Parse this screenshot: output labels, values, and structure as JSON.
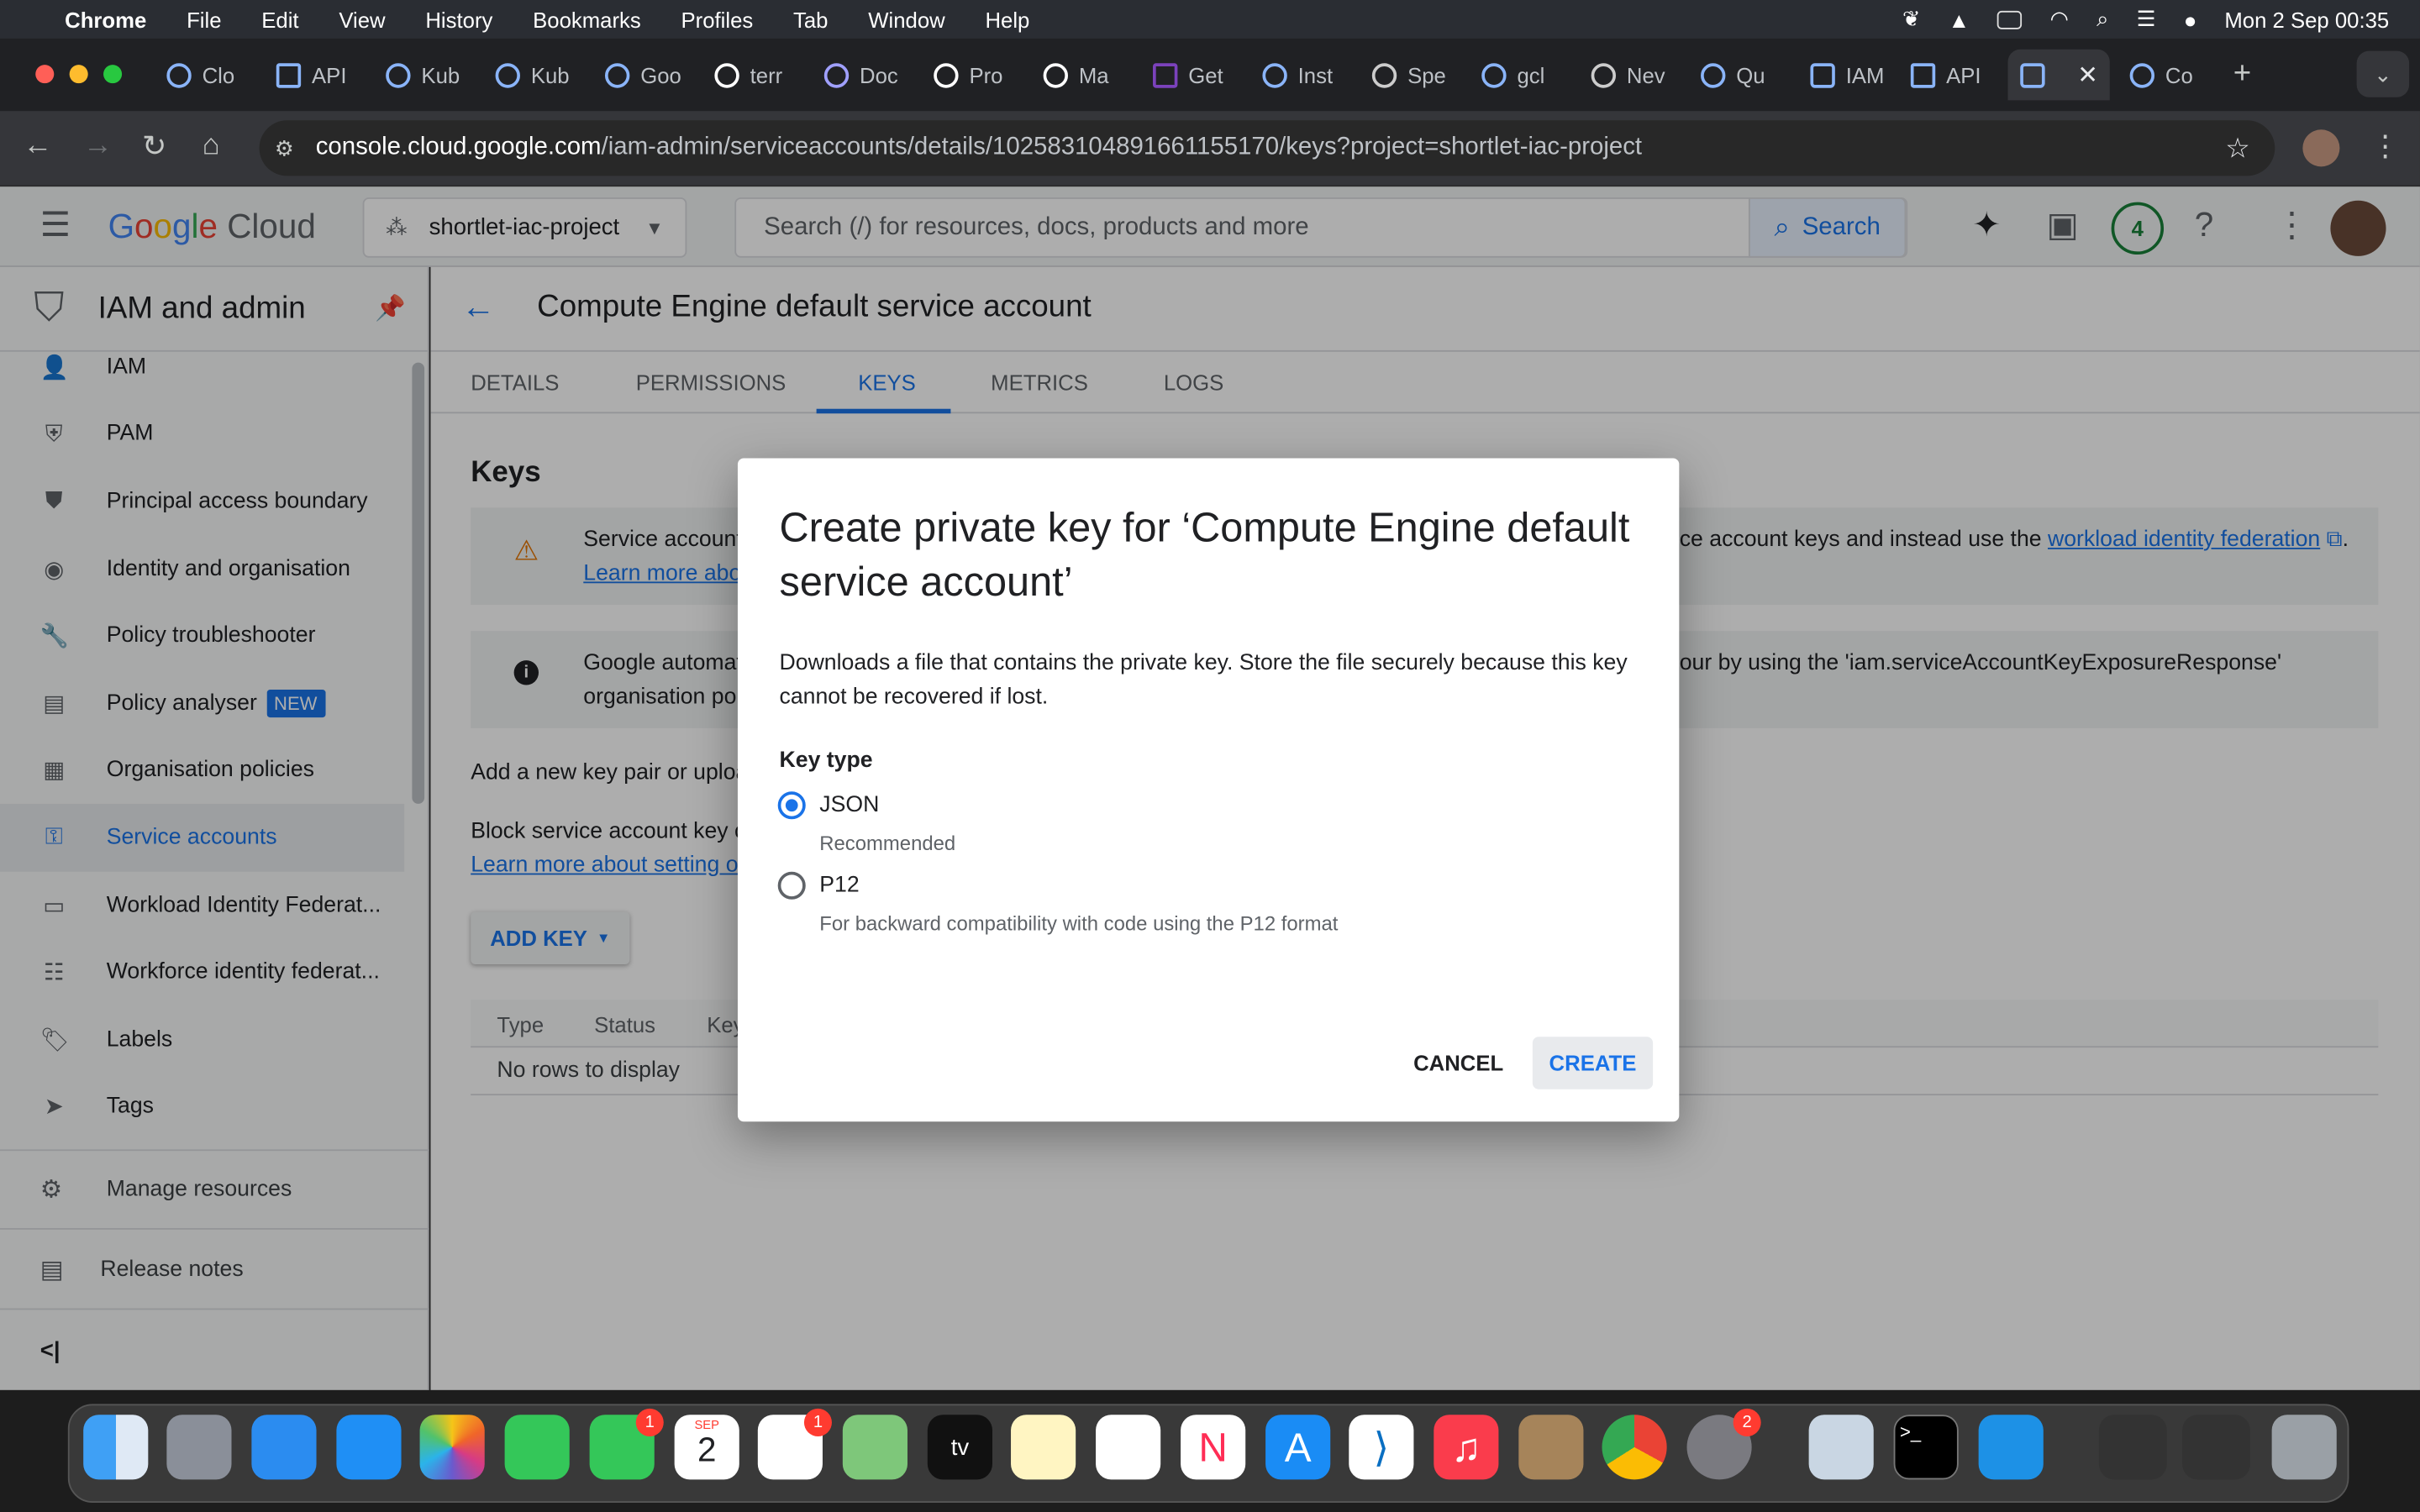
{
  "menubar": {
    "apple": "",
    "app": "Chrome",
    "items": [
      "File",
      "Edit",
      "View",
      "History",
      "Bookmarks",
      "Profiles",
      "Tab",
      "Window",
      "Help"
    ],
    "clock": "Mon 2 Sep  00:35"
  },
  "browser": {
    "tabs": [
      "Clo",
      "API",
      "Kub",
      "Kub",
      "Goo",
      "terr",
      "Doc",
      "Pro",
      "Ma",
      "Get",
      "Inst",
      "Spe",
      "gcl",
      "Nev",
      "Qu",
      "IAM",
      "API",
      "",
      "Co"
    ],
    "url_host": "console.cloud.google.com",
    "url_path": "/iam-admin/serviceaccounts/details/102583104891661155170/keys?project=shortlet-iac-project"
  },
  "gcp": {
    "logo": "Google Cloud",
    "project": "shortlet-iac-project",
    "search_placeholder": "Search (/) for resources, docs, products and more",
    "search_button": "Search",
    "notifications": "4"
  },
  "sidebar": {
    "title": "IAM and admin",
    "items": [
      {
        "label": "IAM",
        "icon": "person-add-icon"
      },
      {
        "label": "PAM",
        "icon": "shield-icon"
      },
      {
        "label": "Principal access boundary",
        "icon": "boundary-icon"
      },
      {
        "label": "Identity and organisation",
        "icon": "account-circle-icon"
      },
      {
        "label": "Policy troubleshooter",
        "icon": "wrench-icon"
      },
      {
        "label": "Policy analyser",
        "icon": "policy-icon",
        "badge": "NEW"
      },
      {
        "label": "Organisation policies",
        "icon": "document-icon"
      },
      {
        "label": "Service accounts",
        "icon": "service-account-icon"
      },
      {
        "label": "Workload Identity Federat...",
        "icon": "id-card-icon"
      },
      {
        "label": "Workforce identity federat...",
        "icon": "list-icon"
      },
      {
        "label": "Labels",
        "icon": "label-icon"
      },
      {
        "label": "Tags",
        "icon": "tag-icon"
      }
    ],
    "manage_resources": "Manage resources",
    "release_notes": "Release notes",
    "collapse": "<|"
  },
  "page": {
    "title": "Compute Engine default service account",
    "tabs": [
      "DETAILS",
      "PERMISSIONS",
      "KEYS",
      "METRICS",
      "LOGS"
    ],
    "keys_heading": "Keys",
    "warning_text_start": "Service account",
    "warning_text_end": "ice account keys and instead use the",
    "warning_link": "workload identity federation",
    "warning_learn": "Learn more abou",
    "info_text_start": "Google automat",
    "info_text_end": "iour by using the 'iam.serviceAccountKeyExposureResponse'",
    "info_line2": "organisation pol",
    "add_pair_text": "Add a new key pair or uploa",
    "block_text": "Block service account key c",
    "block_link": "Learn more about setting or",
    "add_key": "ADD KEY",
    "table_headers": [
      "Type",
      "Status",
      "Key"
    ],
    "no_rows": "No rows to display"
  },
  "dialog": {
    "title": "Create private key for ‘Compute Engine default service account’",
    "description": "Downloads a file that contains the private key. Store the file securely because this key cannot be recovered if lost.",
    "key_type_label": "Key type",
    "options": [
      {
        "label": "JSON",
        "sub": "Recommended",
        "selected": true
      },
      {
        "label": "P12",
        "sub": "For backward compatibility with code using the P12 format",
        "selected": false
      }
    ],
    "cancel": "CANCEL",
    "create": "CREATE"
  },
  "dock": {
    "badges": {
      "messages": "1",
      "reminders": "1",
      "settings": "2"
    },
    "calendar_month": "SEP",
    "calendar_day": "2"
  },
  "colors": {
    "accent": "#1a73e8",
    "overlay": "rgba(0,0,0,0.32)"
  }
}
